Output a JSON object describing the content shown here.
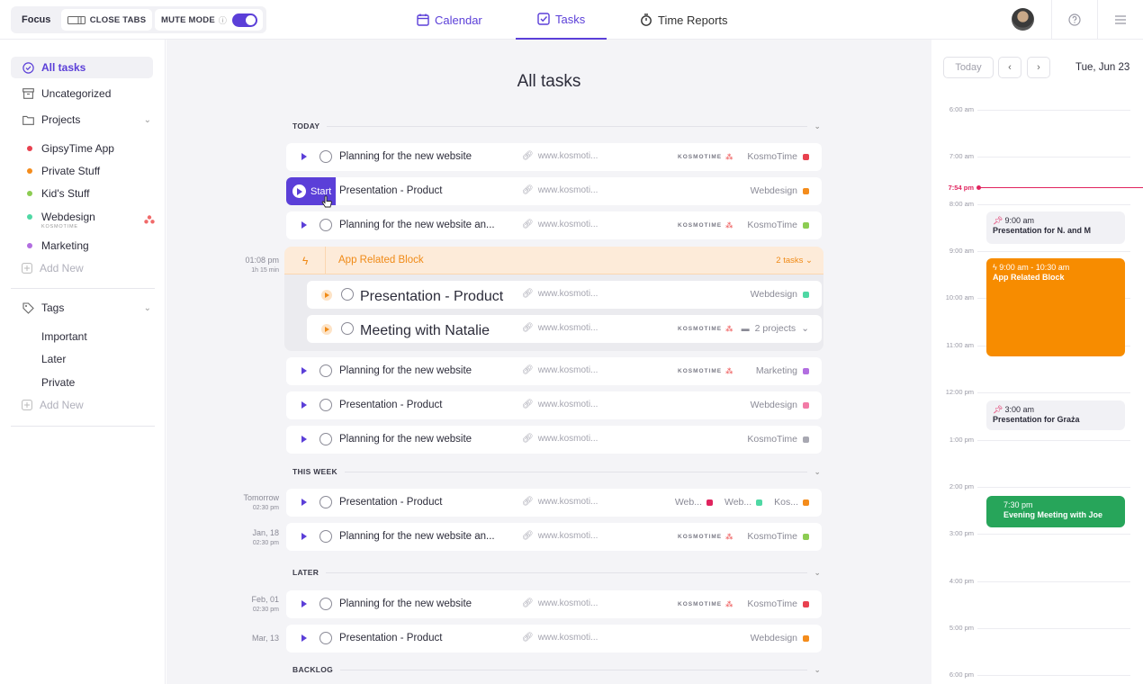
{
  "topbar": {
    "focus": "Focus",
    "close_tabs": "CLOSE TABS",
    "mute_mode": "MUTE MODE",
    "tabs": [
      {
        "label": "Calendar",
        "icon": "calendar-icon"
      },
      {
        "label": "Tasks",
        "icon": "tasks-icon"
      },
      {
        "label": "Time Reports",
        "icon": "stopwatch-icon"
      }
    ]
  },
  "sidebar": {
    "all_tasks": "All tasks",
    "uncategorized": "Uncategorized",
    "projects": "Projects",
    "project_list": [
      {
        "name": "GipsyTime App",
        "color": "#e8414f"
      },
      {
        "name": "Private Stuff",
        "color": "#f48c1c"
      },
      {
        "name": "Kid's Stuff",
        "color": "#8ccc52"
      },
      {
        "name": "Webdesign",
        "sub": "KOSMOTIME",
        "color": "#4fd8a4"
      },
      {
        "name": "Marketing",
        "color": "#b26ee0"
      }
    ],
    "add_new": "Add New",
    "tags": "Tags",
    "tag_list": [
      "Important",
      "Later",
      "Private"
    ],
    "add_new_tag": "Add New"
  },
  "main": {
    "title": "All tasks",
    "sections": {
      "today": "TODAY",
      "this_week": "THIS WEEK",
      "later": "LATER",
      "backlog": "BACKLOG"
    },
    "start_label": "Start",
    "brand": "KOSMOTIME",
    "link": "www.kosmoti...",
    "rows": [
      {
        "title": "Planning for the new website",
        "project": "KosmoTime",
        "color": "#e8414f",
        "brand": true
      },
      {
        "title": "Presentation - Product",
        "project": "Webdesign",
        "color": "#f48c1c",
        "brand": false
      },
      {
        "title": "Planning for the new website an...",
        "project": "KosmoTime",
        "color": "#8ccc52",
        "brand": true
      },
      {
        "title": "Planning for the new website",
        "project": "Marketing",
        "color": "#b26ee0",
        "brand": true
      },
      {
        "title": "Presentation - Product",
        "project": "Webdesign",
        "color": "#f27aa6",
        "brand": false
      },
      {
        "title": "Planning for the new website",
        "project": "KosmoTime",
        "color": "#a8a8b2",
        "brand": false
      },
      {
        "title": "Presentation - Product",
        "project": "",
        "color": "",
        "brand": false
      },
      {
        "title": "Planning for the new website an...",
        "project": "KosmoTime",
        "color": "#8ccc52",
        "brand": true
      },
      {
        "title": "Planning for the new website",
        "project": "KosmoTime",
        "color": "#e8414f",
        "brand": true
      },
      {
        "title": "Presentation - Product",
        "project": "Webdesign",
        "color": "#f48c1c",
        "brand": false
      }
    ],
    "multi_tags": [
      {
        "label": "Web...",
        "color": "#e0245e"
      },
      {
        "label": "Web...",
        "color": "#4fd8a4"
      },
      {
        "label": "Kos...",
        "color": "#f48c1c"
      }
    ],
    "block": {
      "time": "01:08 pm",
      "duration": "1h 15 min",
      "title": "App  Related Block",
      "count": "2 tasks",
      "sub": [
        {
          "title": "Presentation - Product",
          "project": "Webdesign",
          "color": "#4fd8a4"
        },
        {
          "title": "Meeting with Natalie",
          "project": "2 projects"
        }
      ]
    },
    "times": {
      "tomorrow": "Tomorrow",
      "tomorrow_t": "02:30 pm",
      "jan": "Jan, 18",
      "jan_t": "02:30 pm",
      "feb": "Feb, 01",
      "feb_t": "02:30 pm",
      "mar": "Mar, 13"
    }
  },
  "calendar": {
    "today": "Today",
    "date": "Tue, Jun 23",
    "now": "7:54 pm",
    "hours": [
      "6:00 am",
      "7:00 am",
      "8:00 am",
      "9:00 am",
      "10:00 am",
      "11:00 am",
      "12:00 pm",
      "1:00 pm",
      "2:00 pm",
      "3:00 pm",
      "4:00 pm",
      "5:00 pm",
      "6:00 pm"
    ],
    "events": [
      {
        "time": "9:00 am",
        "title": "Presentation for N. and M"
      },
      {
        "time": "9:00 am - 10:30 am",
        "title": "App  Related Block"
      },
      {
        "time": "3:00 am",
        "title": "Presentation for Graża"
      },
      {
        "time": "7:30 pm",
        "title": "Evening Meeting with Joe"
      }
    ],
    "colors": {
      "block": "#f78c00",
      "green": "#27a55a"
    }
  }
}
